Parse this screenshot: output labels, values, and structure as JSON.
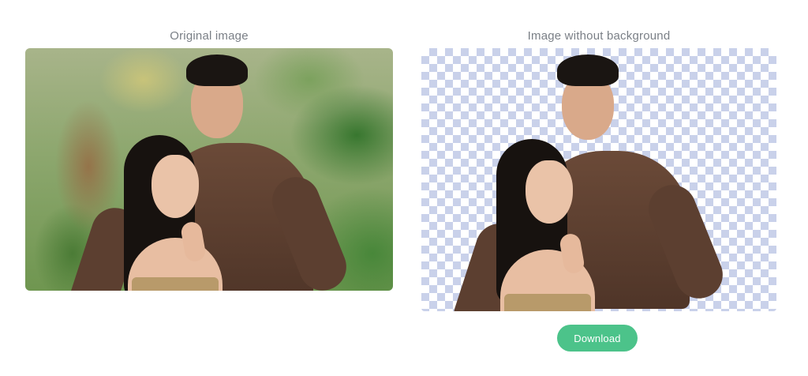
{
  "original": {
    "title": "Original image"
  },
  "result": {
    "title": "Image without background"
  },
  "actions": {
    "download_label": "Download"
  },
  "colors": {
    "accent": "#4cc38a",
    "title_text": "#7a7f86",
    "checker_blue": "#c9d1ea"
  }
}
